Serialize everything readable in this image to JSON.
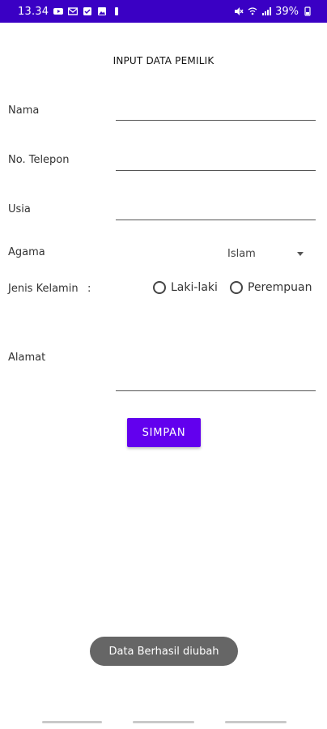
{
  "status_bar": {
    "time": "13.34",
    "battery": "39%",
    "bg_color": "#3a00c4"
  },
  "form": {
    "title": "INPUT DATA PEMILIK",
    "nama_label": "Nama",
    "nama_value": "",
    "telepon_label": "No. Telepon",
    "telepon_value": "",
    "usia_label": "Usia",
    "usia_value": "",
    "agama_label": "Agama",
    "agama_selected": "Islam",
    "jenis_kelamin_label": "Jenis Kelamin",
    "jenis_kelamin_colon": ":",
    "gender_options": [
      "Laki-laki",
      "Perempuan"
    ],
    "alamat_label": "Alamat",
    "alamat_value": "",
    "submit_label": "SIMPAN"
  },
  "toast": {
    "message": "Data Berhasil diubah"
  },
  "colors": {
    "primary": "#6200ee",
    "toast_bg": "#666666"
  }
}
